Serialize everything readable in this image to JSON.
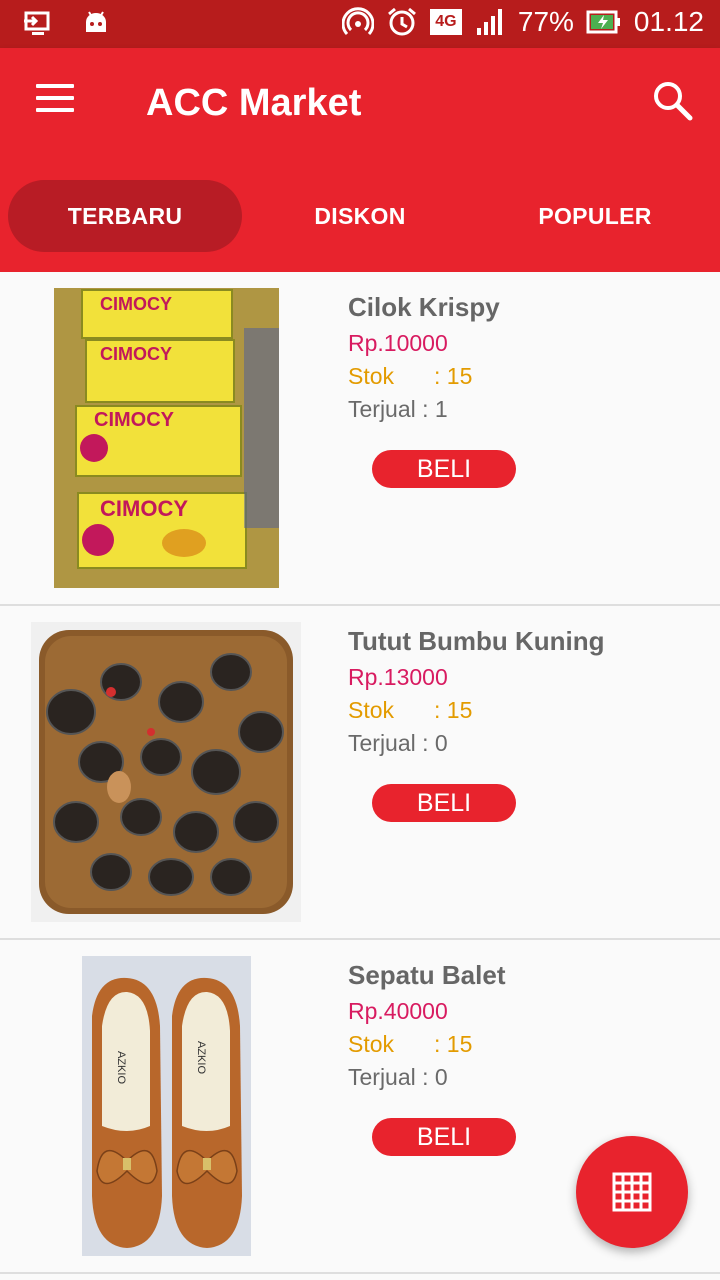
{
  "status_bar": {
    "battery": "77%",
    "network": "4G",
    "time": "01.12"
  },
  "app_bar": {
    "title": "ACC Market",
    "menu_icon": "menu-icon",
    "search_icon": "search-icon"
  },
  "tabs": [
    {
      "label": "TERBARU",
      "active": true
    },
    {
      "label": "DISKON",
      "active": false
    },
    {
      "label": "POPULER",
      "active": false
    }
  ],
  "products": [
    {
      "name": "Cilok Krispy",
      "price": "Rp.10000",
      "stock_label": "Stok",
      "stock_value": ": 15",
      "sold": "Terjual : 1",
      "buy_label": "BELI",
      "image_text": "CIMOCY"
    },
    {
      "name": "Tutut Bumbu Kuning",
      "price": "Rp.13000",
      "stock_label": "Stok",
      "stock_value": ": 15",
      "sold": "Terjual : 0",
      "buy_label": "BELI"
    },
    {
      "name": "Sepatu Balet",
      "price": "Rp.40000",
      "stock_label": "Stok",
      "stock_value": ": 15",
      "sold": "Terjual : 0",
      "buy_label": "BELI",
      "image_text": "AZKIO"
    }
  ],
  "fab": {
    "icon": "grid-icon"
  },
  "colors": {
    "primary": "#e8232d",
    "status_bar": "#b71c1c",
    "price": "#d81b60",
    "stock": "#e39b00"
  }
}
